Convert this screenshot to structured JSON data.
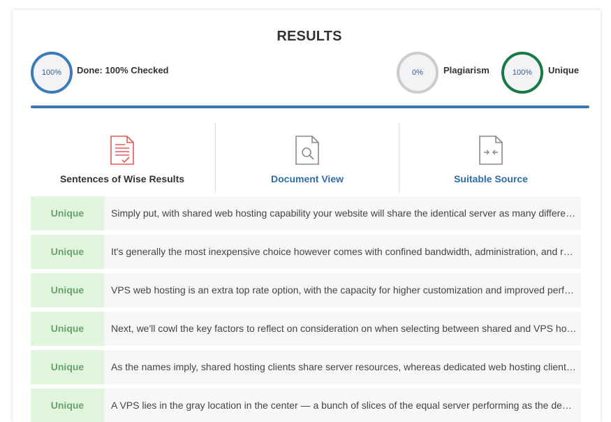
{
  "results": {
    "title": "RESULTS",
    "done": {
      "percent": "100%",
      "label": "Done: 100% Checked"
    },
    "plagiarism": {
      "percent": "0%",
      "label": "Plagiarism"
    },
    "unique": {
      "percent": "100%",
      "label": "Unique"
    },
    "progress_fraction": 1.0
  },
  "colors": {
    "accent_blue": "#3c78b5",
    "ring_gray": "#cccccc",
    "ring_green": "#167a47",
    "badge_bg": "#e1f5dc",
    "badge_text": "#6aa36f",
    "icon_red": "#e05a5a"
  },
  "tabs": [
    {
      "label": "Sentences of Wise Results",
      "icon": "document-check-icon"
    },
    {
      "label": "Document View",
      "icon": "document-search-icon"
    },
    {
      "label": "Suitable Source",
      "icon": "document-compare-icon"
    }
  ],
  "rows": [
    {
      "status": "Unique",
      "text": "Simply put, with shared web hosting capability your website will share the identical server as many different websites"
    },
    {
      "status": "Unique",
      "text": "It's generally the most inexpensive choice however comes with confined bandwidth, administration, and resources"
    },
    {
      "status": "Unique",
      "text": "VPS web hosting is an extra top rate option, with the capacity for higher customization and improved performance"
    },
    {
      "status": "Unique",
      "text": "Next, we'll cowl the key factors to reflect on consideration on when selecting between shared and VPS hosting"
    },
    {
      "status": "Unique",
      "text": "As the names imply, shared hosting clients share server resources, whereas dedicated web hosting clients do not"
    },
    {
      "status": "Unique",
      "text": "A VPS lies in the gray location in the center — a bunch of slices of the equal server performing as the dedicated"
    }
  ]
}
